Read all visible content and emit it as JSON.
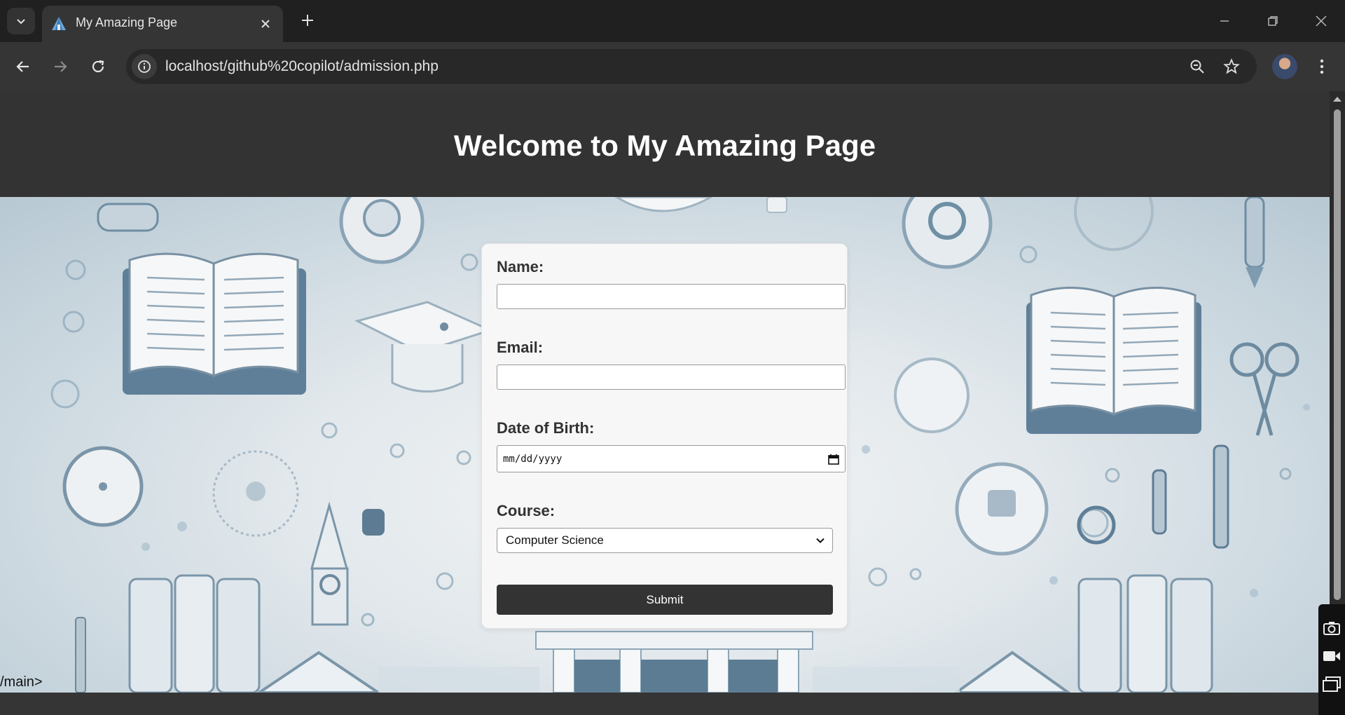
{
  "browser": {
    "tab_title": "My Amazing Page",
    "url": "localhost/github%20copilot/admission.php"
  },
  "page": {
    "title": "Welcome to My Amazing Page",
    "stray_text": "/main>"
  },
  "form": {
    "name_label": "Name:",
    "name_value": "",
    "email_label": "Email:",
    "email_value": "",
    "dob_label": "Date of Birth:",
    "dob_placeholder": "mm/dd/yyyy",
    "course_label": "Course:",
    "course_selected": "Computer Science",
    "submit_label": "Submit"
  },
  "colors": {
    "chrome_dark": "#202020",
    "header_bg": "#333333",
    "button_bg": "#333333",
    "card_bg": "#f7f7f7"
  },
  "icons": [
    "tab-search-icon",
    "favicon-icon",
    "close-icon",
    "plus-icon",
    "minimize-icon",
    "restore-icon",
    "back-icon",
    "forward-icon",
    "reload-icon",
    "info-icon",
    "zoom-icon",
    "star-icon",
    "kebab-menu-icon",
    "calendar-icon",
    "chevron-down-icon",
    "camera-icon",
    "video-icon",
    "window-icon"
  ]
}
